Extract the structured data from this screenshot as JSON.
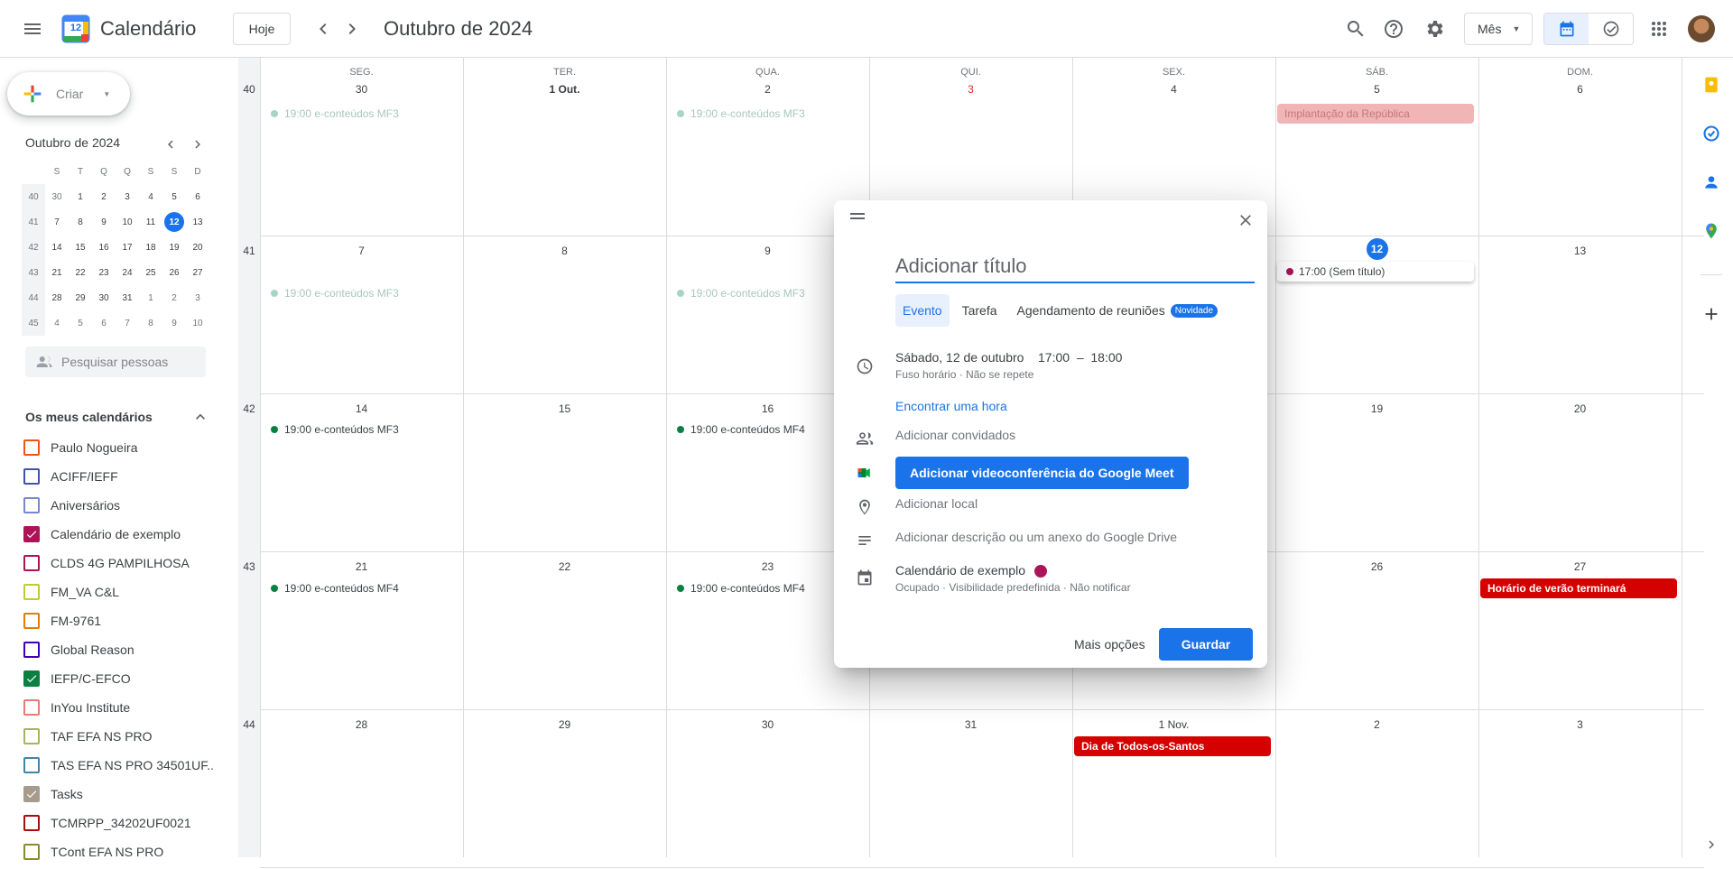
{
  "header": {
    "app_title": "Calendário",
    "logo_day": "12",
    "today_label": "Hoje",
    "month_title": "Outubro de 2024",
    "view_label": "Mês"
  },
  "sidebar": {
    "create_label": "Criar",
    "mini_title": "Outubro de 2024",
    "mini_headers": [
      "S",
      "T",
      "Q",
      "Q",
      "S",
      "S",
      "D"
    ],
    "mini_weeks": [
      {
        "wk": "40",
        "days": [
          "30",
          "1",
          "2",
          "3",
          "4",
          "5",
          "6"
        ]
      },
      {
        "wk": "41",
        "days": [
          "7",
          "8",
          "9",
          "10",
          "11",
          "12",
          "13"
        ]
      },
      {
        "wk": "42",
        "days": [
          "14",
          "15",
          "16",
          "17",
          "18",
          "19",
          "20"
        ]
      },
      {
        "wk": "43",
        "days": [
          "21",
          "22",
          "23",
          "24",
          "25",
          "26",
          "27"
        ]
      },
      {
        "wk": "44",
        "days": [
          "28",
          "29",
          "30",
          "31",
          "1",
          "2",
          "3"
        ]
      },
      {
        "wk": "45",
        "days": [
          "4",
          "5",
          "6",
          "7",
          "8",
          "9",
          "10"
        ]
      }
    ],
    "search_placeholder": "Pesquisar pessoas",
    "my_calendars_title": "Os meus calendários",
    "calendars": [
      {
        "name": "Paulo Nogueira",
        "color": "#f4511e",
        "checked": false
      },
      {
        "name": "ACIFF/IEFF",
        "color": "#3f51b5",
        "checked": false
      },
      {
        "name": "Aniversários",
        "color": "#7986cb",
        "checked": false
      },
      {
        "name": "Calendário de exemplo",
        "color": "#ad1457",
        "checked": true
      },
      {
        "name": "CLDS 4G PAMPILHOSA",
        "color": "#ad1457",
        "checked": false
      },
      {
        "name": "FM_VA C&L",
        "color": "#c0ca33",
        "checked": false
      },
      {
        "name": "FM-9761",
        "color": "#e67c00",
        "checked": false
      },
      {
        "name": "Global Reason",
        "color": "#3f00b5",
        "checked": false
      },
      {
        "name": "IEFP/C-EFCO",
        "color": "#0b8043",
        "checked": true
      },
      {
        "name": "InYou Institute",
        "color": "#e67c73",
        "checked": false
      },
      {
        "name": "TAF EFA NS PRO",
        "color": "#a8b35b",
        "checked": false
      },
      {
        "name": "TAS EFA NS PRO 34501UF...",
        "color": "#4285a4",
        "checked": false
      },
      {
        "name": "Tasks",
        "color": "#a79b8e",
        "checked": true
      },
      {
        "name": "TCMRPP_34202UF0021",
        "color": "#a50e0e",
        "checked": false
      },
      {
        "name": "TCont EFA NS PRO",
        "color": "#8a8a32",
        "checked": false
      }
    ]
  },
  "grid": {
    "dows": [
      "SEG.",
      "TER.",
      "QUA.",
      "QUI.",
      "SEX.",
      "SÁB.",
      "DOM."
    ],
    "weeks": [
      {
        "wk": "40",
        "days": [
          "30",
          "1 Out.",
          "2",
          "3",
          "4",
          "5",
          "6"
        ]
      },
      {
        "wk": "41",
        "days": [
          "7",
          "8",
          "9",
          "",
          "",
          "12",
          "13"
        ]
      },
      {
        "wk": "42",
        "days": [
          "14",
          "15",
          "16",
          "",
          "",
          "19",
          "20"
        ]
      },
      {
        "wk": "43",
        "days": [
          "21",
          "22",
          "23",
          "",
          "",
          "26",
          "27"
        ]
      },
      {
        "wk": "44",
        "days": [
          "28",
          "29",
          "30",
          "31",
          "1 Nov.",
          "2",
          "3"
        ]
      }
    ],
    "events": {
      "e1": "19:00 e-conteúdos MF3",
      "e2": "19:00 e-conteúdos MF3",
      "e3": "19:00 e-conteúdos MF3",
      "e4": "19:00 e-conteúdos MF3",
      "e5": "19:00 e-conteúdos MF3",
      "e6": "19:00 e-conteúdos MF4",
      "e7": "19:00 e-conteúdos MF4",
      "e8": "19:00 e-conteúdos MF4",
      "republica": "Implantação da República",
      "untitled": "17:00 (Sem título)",
      "verao": "Horário de verão terminará",
      "santos": "Dia de Todos-os-Santos"
    }
  },
  "modal": {
    "title_placeholder": "Adicionar título",
    "tab_event": "Evento",
    "tab_task": "Tarefa",
    "tab_appointment": "Agendamento de reuniões",
    "tab_badge": "Novidade",
    "date_line": "Sábado, 12 de outubro    17:00  –  18:00",
    "date_sub": "Fuso horário · Não se repete",
    "find_time": "Encontrar uma hora",
    "add_guests": "Adicionar convidados",
    "meet_button": "Adicionar videoconferência do Google Meet",
    "add_location": "Adicionar local",
    "add_description": "Adicionar descrição ou um anexo do Google Drive",
    "calendar_name": "Calendário de exemplo",
    "calendar_sub": "Ocupado · Visibilidade predefinida · Não notificar",
    "more_options": "Mais opções",
    "save": "Guardar"
  }
}
